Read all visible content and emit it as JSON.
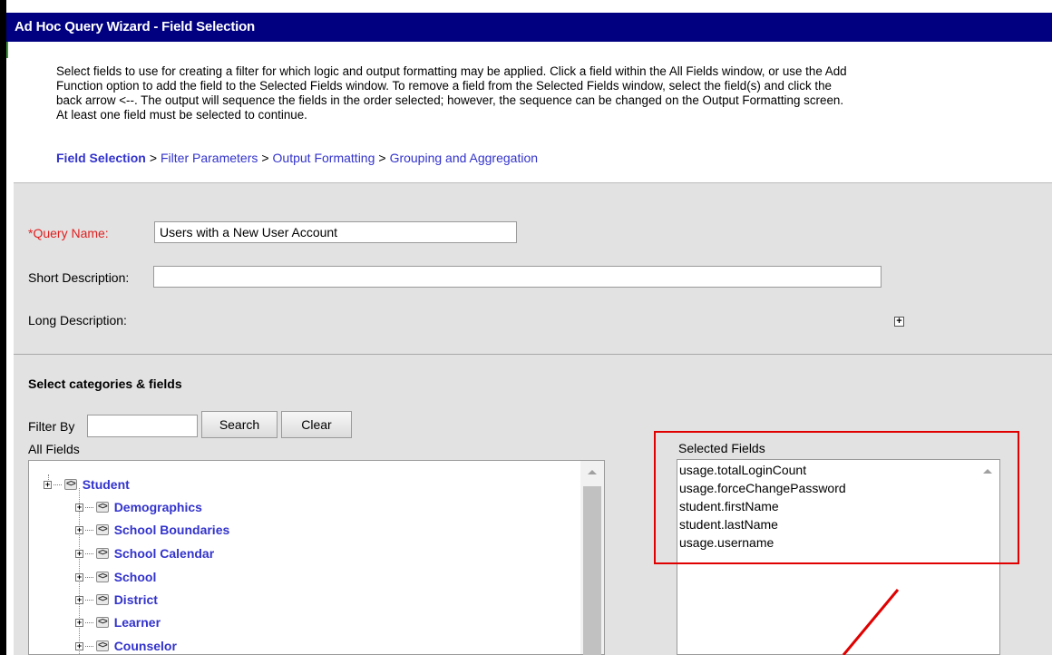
{
  "window": {
    "title": "Ad Hoc Query Wizard - Field Selection"
  },
  "intro": {
    "lines": [
      "Select fields to use for creating a filter for which logic and output formatting may be applied. Click a field within the All Fields window, or use the Add",
      "Function option to add the field to the Selected Fields window. To remove a field from the Selected Fields window, select the field(s) and click the",
      "back arrow <--. The output will sequence the fields in the order selected; however, the sequence can be changed on the Output Formatting screen.",
      "At least one field must be selected to continue."
    ]
  },
  "breadcrumb": {
    "items": [
      "Field Selection",
      "Filter Parameters",
      "Output Formatting",
      "Grouping and Aggregation"
    ],
    "separator": ">"
  },
  "form": {
    "query_name_label": "*Query Name:",
    "query_name_value": "Users with a New User Account",
    "short_description_label": "Short Description:",
    "short_description_value": "",
    "long_description_label": "Long Description:",
    "expand_symbol": "+"
  },
  "fields_section": {
    "title": "Select categories & fields",
    "filter_by_label": "Filter By",
    "filter_value": "",
    "search_button": "Search",
    "clear_button": "Clear",
    "all_fields_label": "All Fields",
    "selected_fields_label": "Selected Fields",
    "object_icon_glyph": "<>",
    "tree": [
      {
        "label": "Student",
        "level": 0
      },
      {
        "label": "Demographics",
        "level": 1
      },
      {
        "label": "School Boundaries",
        "level": 1
      },
      {
        "label": "School Calendar",
        "level": 1
      },
      {
        "label": "School",
        "level": 1
      },
      {
        "label": "District",
        "level": 1
      },
      {
        "label": "Learner",
        "level": 1
      },
      {
        "label": "Counselor",
        "level": 1
      }
    ],
    "selected_fields": [
      "usage.totalLoginCount",
      "usage.forceChangePassword",
      "student.firstName",
      "student.lastName",
      "usage.username"
    ]
  },
  "annotation": {
    "highlight_color": "#e00000"
  },
  "colors": {
    "titlebar": "#000080",
    "link": "#3333cc",
    "required": "#e02020",
    "panel": "#e2e2e2"
  }
}
